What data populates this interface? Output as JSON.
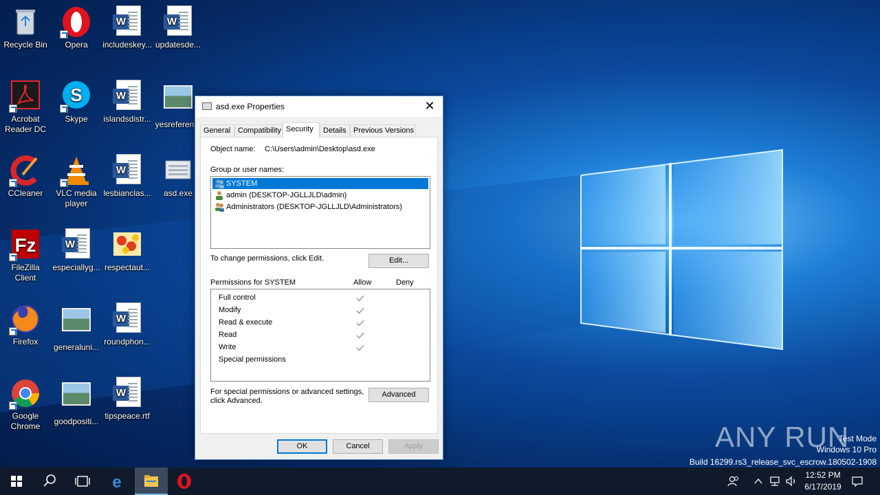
{
  "desktop": {
    "icons": [
      {
        "label": "Recycle Bin"
      },
      {
        "label": "Opera"
      },
      {
        "label": "includeskey..."
      },
      {
        "label": "updatesde..."
      },
      {
        "label": "Acrobat Reader DC"
      },
      {
        "label": "Skype"
      },
      {
        "label": "islandsdistr..."
      },
      {
        "label": "yesreferen..."
      },
      {
        "label": "CCleaner"
      },
      {
        "label": "VLC media player"
      },
      {
        "label": "lesbianclas..."
      },
      {
        "label": "asd.exe"
      },
      {
        "label": "FileZilla Client"
      },
      {
        "label": "especiallyg..."
      },
      {
        "label": "respectaut..."
      },
      {
        "label": "Firefox"
      },
      {
        "label": "generaluni..."
      },
      {
        "label": "roundphon..."
      },
      {
        "label": "Google Chrome"
      },
      {
        "label": "goodpositi..."
      },
      {
        "label": "tipspeace.rtf"
      }
    ]
  },
  "dialog": {
    "title": "asd.exe Properties",
    "tabs": [
      {
        "label": "General"
      },
      {
        "label": "Compatibility"
      },
      {
        "label": "Security"
      },
      {
        "label": "Details"
      },
      {
        "label": "Previous Versions"
      }
    ],
    "object_name_label": "Object name:",
    "object_name_value": "C:\\Users\\admin\\Desktop\\asd.exe",
    "group_label": "Group or user names:",
    "users": [
      {
        "name": "SYSTEM"
      },
      {
        "name": "admin (DESKTOP-JGLLJLD\\admin)"
      },
      {
        "name": "Administrators (DESKTOP-JGLLJLD\\Administrators)"
      }
    ],
    "change_text": "To change permissions, click Edit.",
    "edit_button": "Edit...",
    "permissions_label": "Permissions for SYSTEM",
    "allow_header": "Allow",
    "deny_header": "Deny",
    "permissions": [
      {
        "name": "Full control",
        "allow": true
      },
      {
        "name": "Modify",
        "allow": true
      },
      {
        "name": "Read & execute",
        "allow": true
      },
      {
        "name": "Read",
        "allow": true
      },
      {
        "name": "Write",
        "allow": true
      },
      {
        "name": "Special permissions",
        "allow": false
      }
    ],
    "advanced_text_1": "For special permissions or advanced settings,",
    "advanced_text_2": "click Advanced.",
    "advanced_button": "Advanced",
    "ok_button": "OK",
    "cancel_button": "Cancel",
    "apply_button": "Apply"
  },
  "watermark": {
    "brand": "ANY RUN",
    "line1": "Test Mode",
    "line2": "Windows 10 Pro",
    "line3": "Build 16299.rs3_release_svc_escrow.180502-1908"
  },
  "taskbar": {
    "time": "12:52 PM",
    "date": "6/17/2019"
  }
}
